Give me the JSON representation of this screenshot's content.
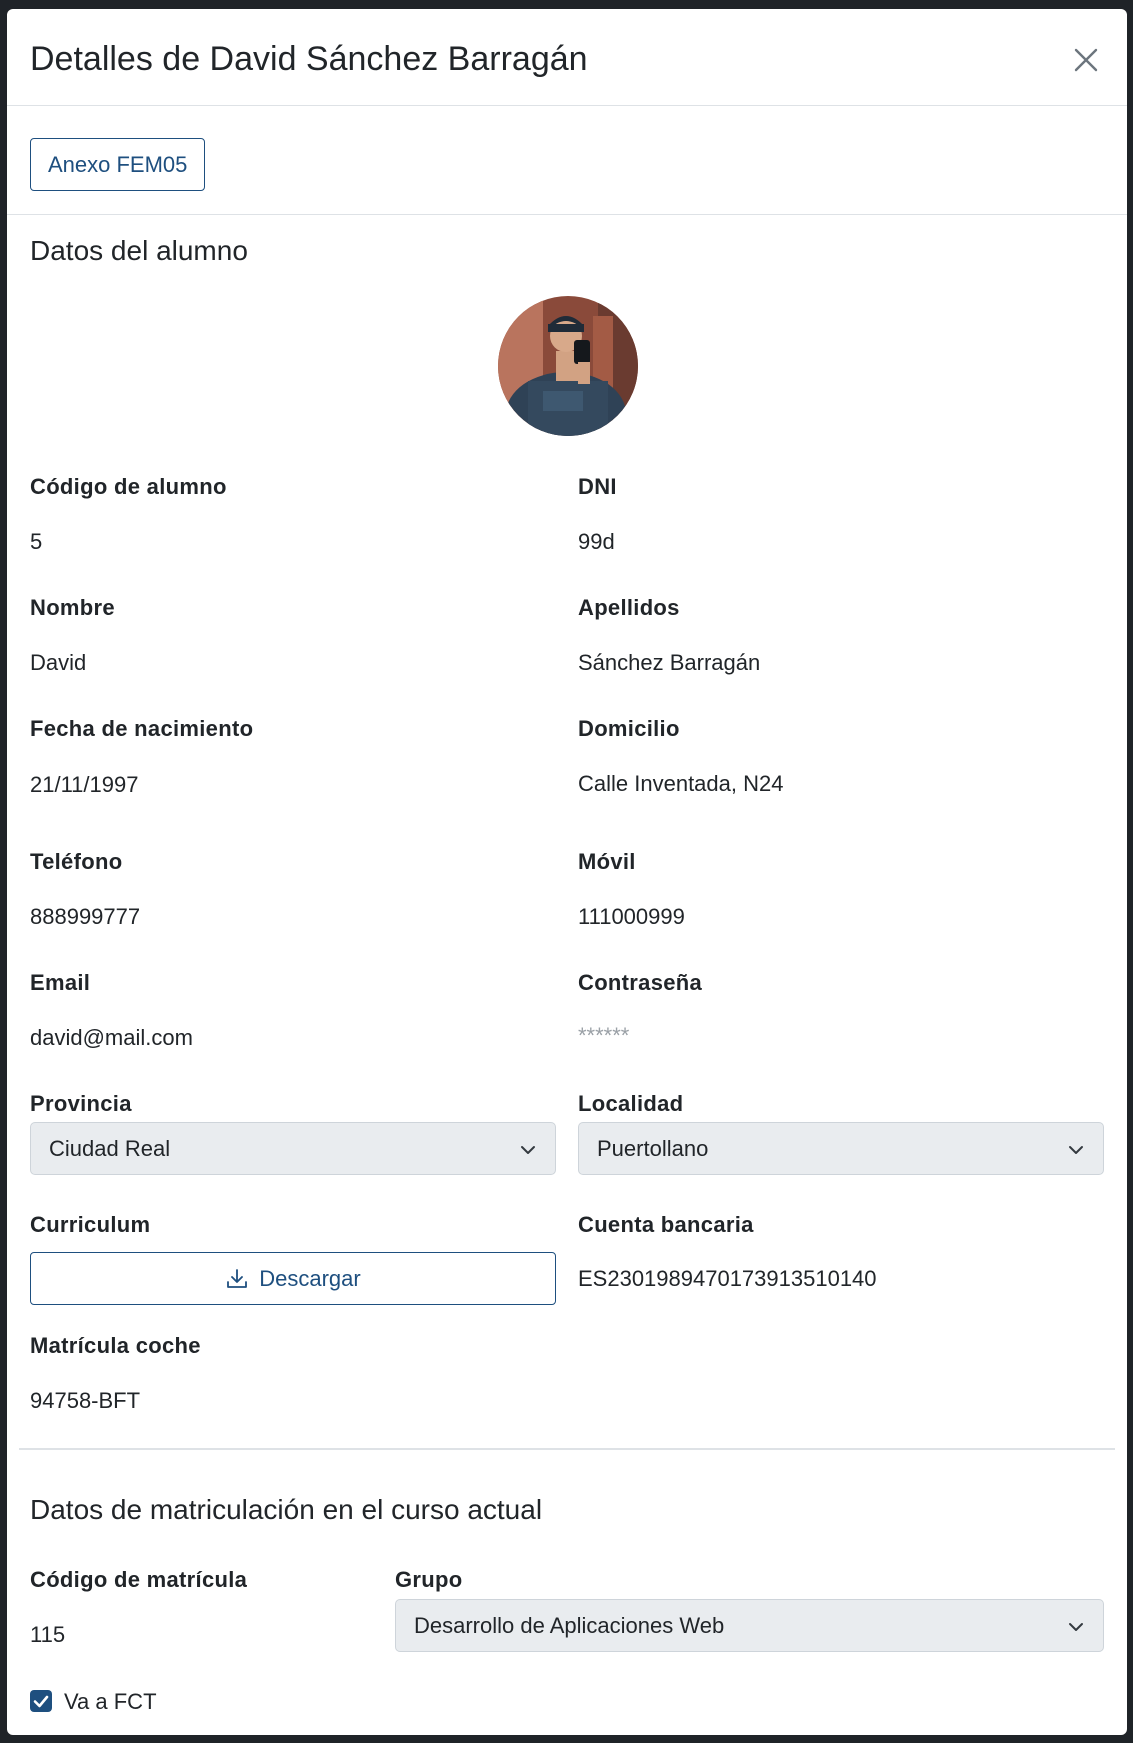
{
  "modal": {
    "title": "Detalles de David Sánchez Barragán",
    "close_icon": "close-icon"
  },
  "toolbar": {
    "annex_button": "Anexo FEM05"
  },
  "student_section": {
    "title": "Datos del alumno",
    "fields": {
      "codigo_label": "Código de alumno",
      "codigo_value": "5",
      "dni_label": "DNI",
      "dni_value": "99d",
      "nombre_label": "Nombre",
      "nombre_value": "David",
      "apellidos_label": "Apellidos",
      "apellidos_value": "Sánchez Barragán",
      "fecha_label": "Fecha de nacimiento",
      "fecha_value": "21/11/1997",
      "domicilio_label": "Domicilio",
      "domicilio_value": "Calle Inventada, N24",
      "telefono_label": "Teléfono",
      "telefono_value": "888999777",
      "movil_label": "Móvil",
      "movil_value": "111000999",
      "email_label": "Email",
      "email_value": "david@mail.com",
      "password_label": "Contraseña",
      "password_value": "******",
      "provincia_label": "Provincia",
      "provincia_value": "Ciudad Real",
      "localidad_label": "Localidad",
      "localidad_value": "Puertollano",
      "curriculum_label": "Curriculum",
      "download_button": "Descargar",
      "cuenta_label": "Cuenta bancaria",
      "cuenta_value": "ES2301989470173913510140",
      "matricula_coche_label": "Matrícula coche",
      "matricula_coche_value": "94758-BFT"
    }
  },
  "enrollment_section": {
    "title": "Datos de matriculación en el curso actual",
    "codigo_matricula_label": "Código de matrícula",
    "codigo_matricula_value": "115",
    "grupo_label": "Grupo",
    "grupo_value": "Desarrollo de Aplicaciones Web",
    "fct_label": "Va a FCT",
    "fct_checked": true
  },
  "colors": {
    "accent": "#1e4f7f",
    "select_bg": "#e9ecef",
    "divider": "#dee2e6"
  }
}
